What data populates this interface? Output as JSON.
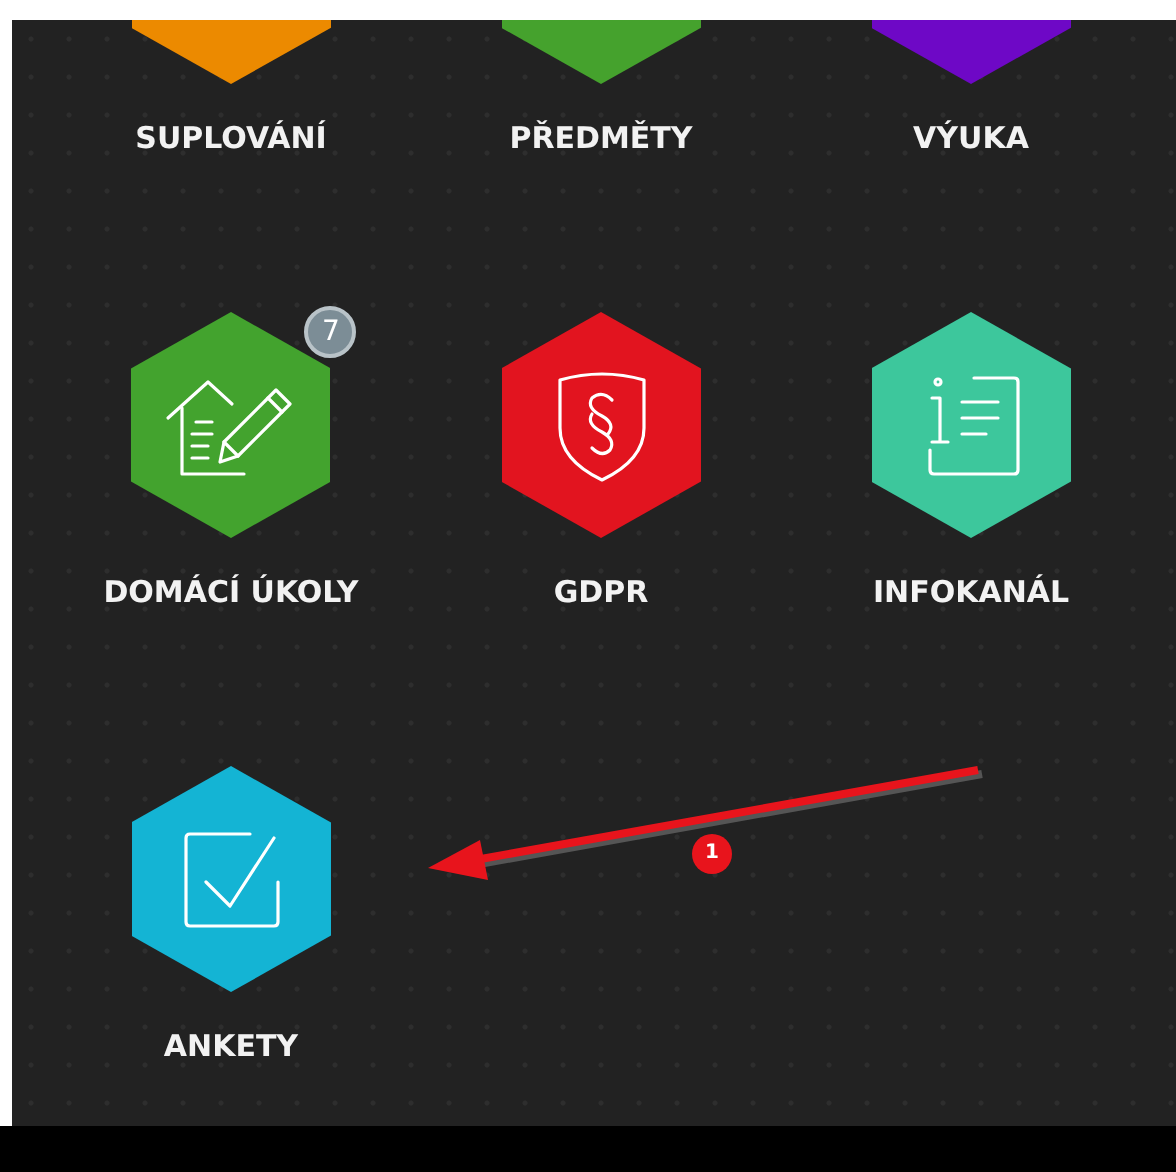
{
  "rows": [
    {
      "partial": true,
      "tiles": [
        {
          "label": "SUPLOVÁNÍ",
          "color": "#ec8a00"
        },
        {
          "label": "PŘEDMĚTY",
          "color": "#45a22d"
        },
        {
          "label": "VÝUKA",
          "color": "#6e08c6"
        }
      ]
    },
    {
      "partial": false,
      "tiles": [
        {
          "label": "DOMÁCÍ ÚKOLY",
          "color": "#43a32e",
          "kind": "homework",
          "badge": "7"
        },
        {
          "label": "GDPR",
          "color": "#e2141f",
          "kind": "shield"
        },
        {
          "label": "INFOKANÁL",
          "color": "#3dc79c",
          "kind": "info"
        }
      ]
    },
    {
      "partial": false,
      "tiles": [
        {
          "label": "ANKETY",
          "color": "#14b4d4",
          "kind": "checkbox"
        }
      ]
    }
  ],
  "annotation": {
    "label": "1"
  }
}
